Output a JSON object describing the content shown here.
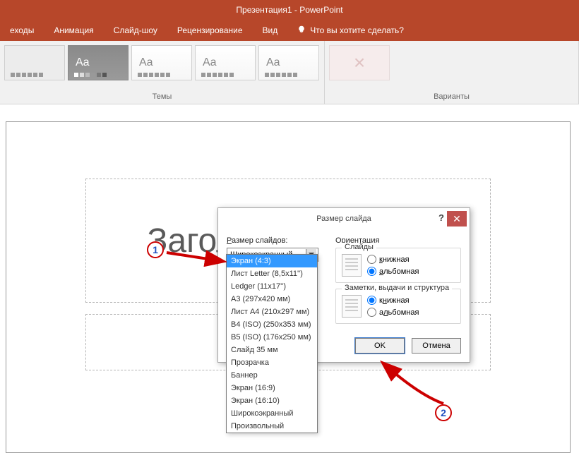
{
  "app": {
    "title": "Презентация1 - PowerPoint"
  },
  "tabs": {
    "items": [
      {
        "label": "еходы"
      },
      {
        "label": "Анимация"
      },
      {
        "label": "Слайд-шоу"
      },
      {
        "label": "Рецензирование"
      },
      {
        "label": "Вид"
      }
    ],
    "tell_me": "Что вы хотите сделать?"
  },
  "ribbon": {
    "themes_label": "Темы",
    "variants_label": "Варианты",
    "aa": "Aa"
  },
  "slide": {
    "title_placeholder": "Заголовок слайда"
  },
  "dialog": {
    "title": "Размер слайда",
    "size_label": "Размер слайдов:",
    "size_value": "Широкоэкранный",
    "orientation_label": "Ориентация",
    "slides_legend": "Слайды",
    "notes_legend": "Заметки, выдачи и структура",
    "portrait": "книжная",
    "landscape": "альбомная",
    "ok": "OK",
    "cancel": "Отмена",
    "size_options": [
      "Экран (4:3)",
      "Лист Letter (8,5x11'')",
      "Ledger (11x17'')",
      "A3 (297x420 мм)",
      "Лист A4 (210x297 мм)",
      "B4 (ISO) (250x353 мм)",
      "B5 (ISO) (176x250 мм)",
      "Слайд 35 мм",
      "Прозрачка",
      "Баннер",
      "Экран (16:9)",
      "Экран (16:10)",
      "Широкоэкранный",
      "Произвольный"
    ]
  },
  "callouts": {
    "one": "1",
    "two": "2"
  }
}
